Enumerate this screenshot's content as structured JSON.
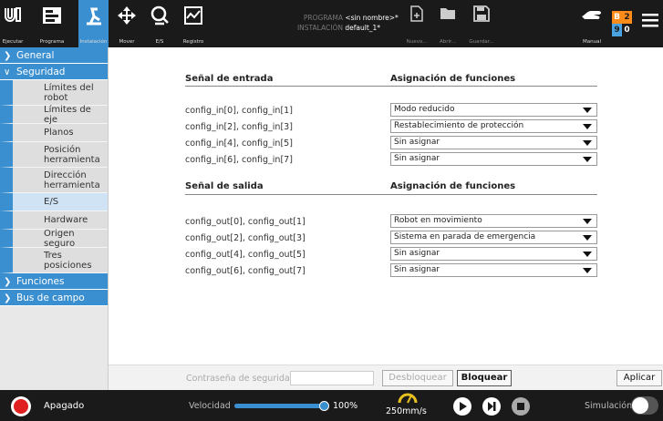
{
  "topbar": {
    "run_label": "Ejecutar",
    "program_label": "Programa",
    "install_label": "Instalación",
    "move_label": "Mover",
    "io_label": "E/S",
    "log_label": "Registro",
    "program_key": "PROGRAMA",
    "program_value": "<sin nombre>*",
    "install_key": "INSTALACIÓN",
    "install_value": "default_1*",
    "new_label": "Nuevo...",
    "open_label": "Abrir...",
    "save_label": "Guardar...",
    "manual_label": "Manual",
    "badge": {
      "b": "B",
      "n2": "2",
      "n9": "9",
      "n0": "0"
    }
  },
  "sidebar": {
    "general": "General",
    "security": "Seguridad",
    "items": [
      "Límites del robot",
      "Límites de eje",
      "Planos",
      "Posición herramienta",
      "Dirección herramienta",
      "E/S",
      "Hardware",
      "Origen seguro",
      "Tres posiciones"
    ],
    "functions": "Funciones",
    "fieldbus": "Bus de campo"
  },
  "main": {
    "input_header": "Señal de entrada",
    "func_header": "Asignación de funciones",
    "output_header": "Señal de salida",
    "inputs": [
      {
        "signal": "config_in[0], config_in[1]",
        "value": "Modo reducido"
      },
      {
        "signal": "config_in[2], config_in[3]",
        "value": "Restablecimiento de protección"
      },
      {
        "signal": "config_in[4], config_in[5]",
        "value": "Sin asignar"
      },
      {
        "signal": "config_in[6], config_in[7]",
        "value": "Sin asignar"
      }
    ],
    "outputs": [
      {
        "signal": "config_out[0], config_out[1]",
        "value": "Robot en movimiento"
      },
      {
        "signal": "config_out[2], config_out[3]",
        "value": "Sistema en parada de emergencia"
      },
      {
        "signal": "config_out[4], config_out[5]",
        "value": "Sin asignar"
      },
      {
        "signal": "config_out[6], config_out[7]",
        "value": "Sin asignar"
      }
    ]
  },
  "password": {
    "label": "Contraseña de seguridad",
    "unlock": "Desbloquear",
    "lock": "Bloquear",
    "apply": "Aplicar"
  },
  "footer": {
    "status": "Apagado",
    "speed_label": "Velocidad",
    "speed_percent": "100%",
    "speed_fraction": 1.0,
    "speed_value": "250mm/s",
    "sim_label": "Simulación"
  },
  "colors": {
    "accent": "#3a8fd0",
    "stop_red": "#e02020",
    "badge_orange": "#ff8c1a",
    "badge_blue": "#4aa3e0"
  }
}
